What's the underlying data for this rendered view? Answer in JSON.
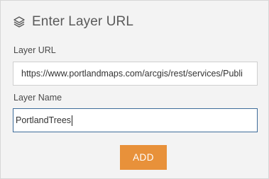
{
  "header": {
    "title": "Enter Layer URL",
    "icon": "layers-icon"
  },
  "form": {
    "url_label": "Layer URL",
    "url_value": "https://www.portlandmaps.com/arcgis/rest/services/Publi",
    "name_label": "Layer Name",
    "name_value": "PortlandTrees"
  },
  "actions": {
    "add_label": "ADD"
  },
  "colors": {
    "panel_bg": "#f3f3f3",
    "accent_button": "#e8913a",
    "focused_border": "#3e6c9a",
    "title_text": "#5a5a5a"
  }
}
